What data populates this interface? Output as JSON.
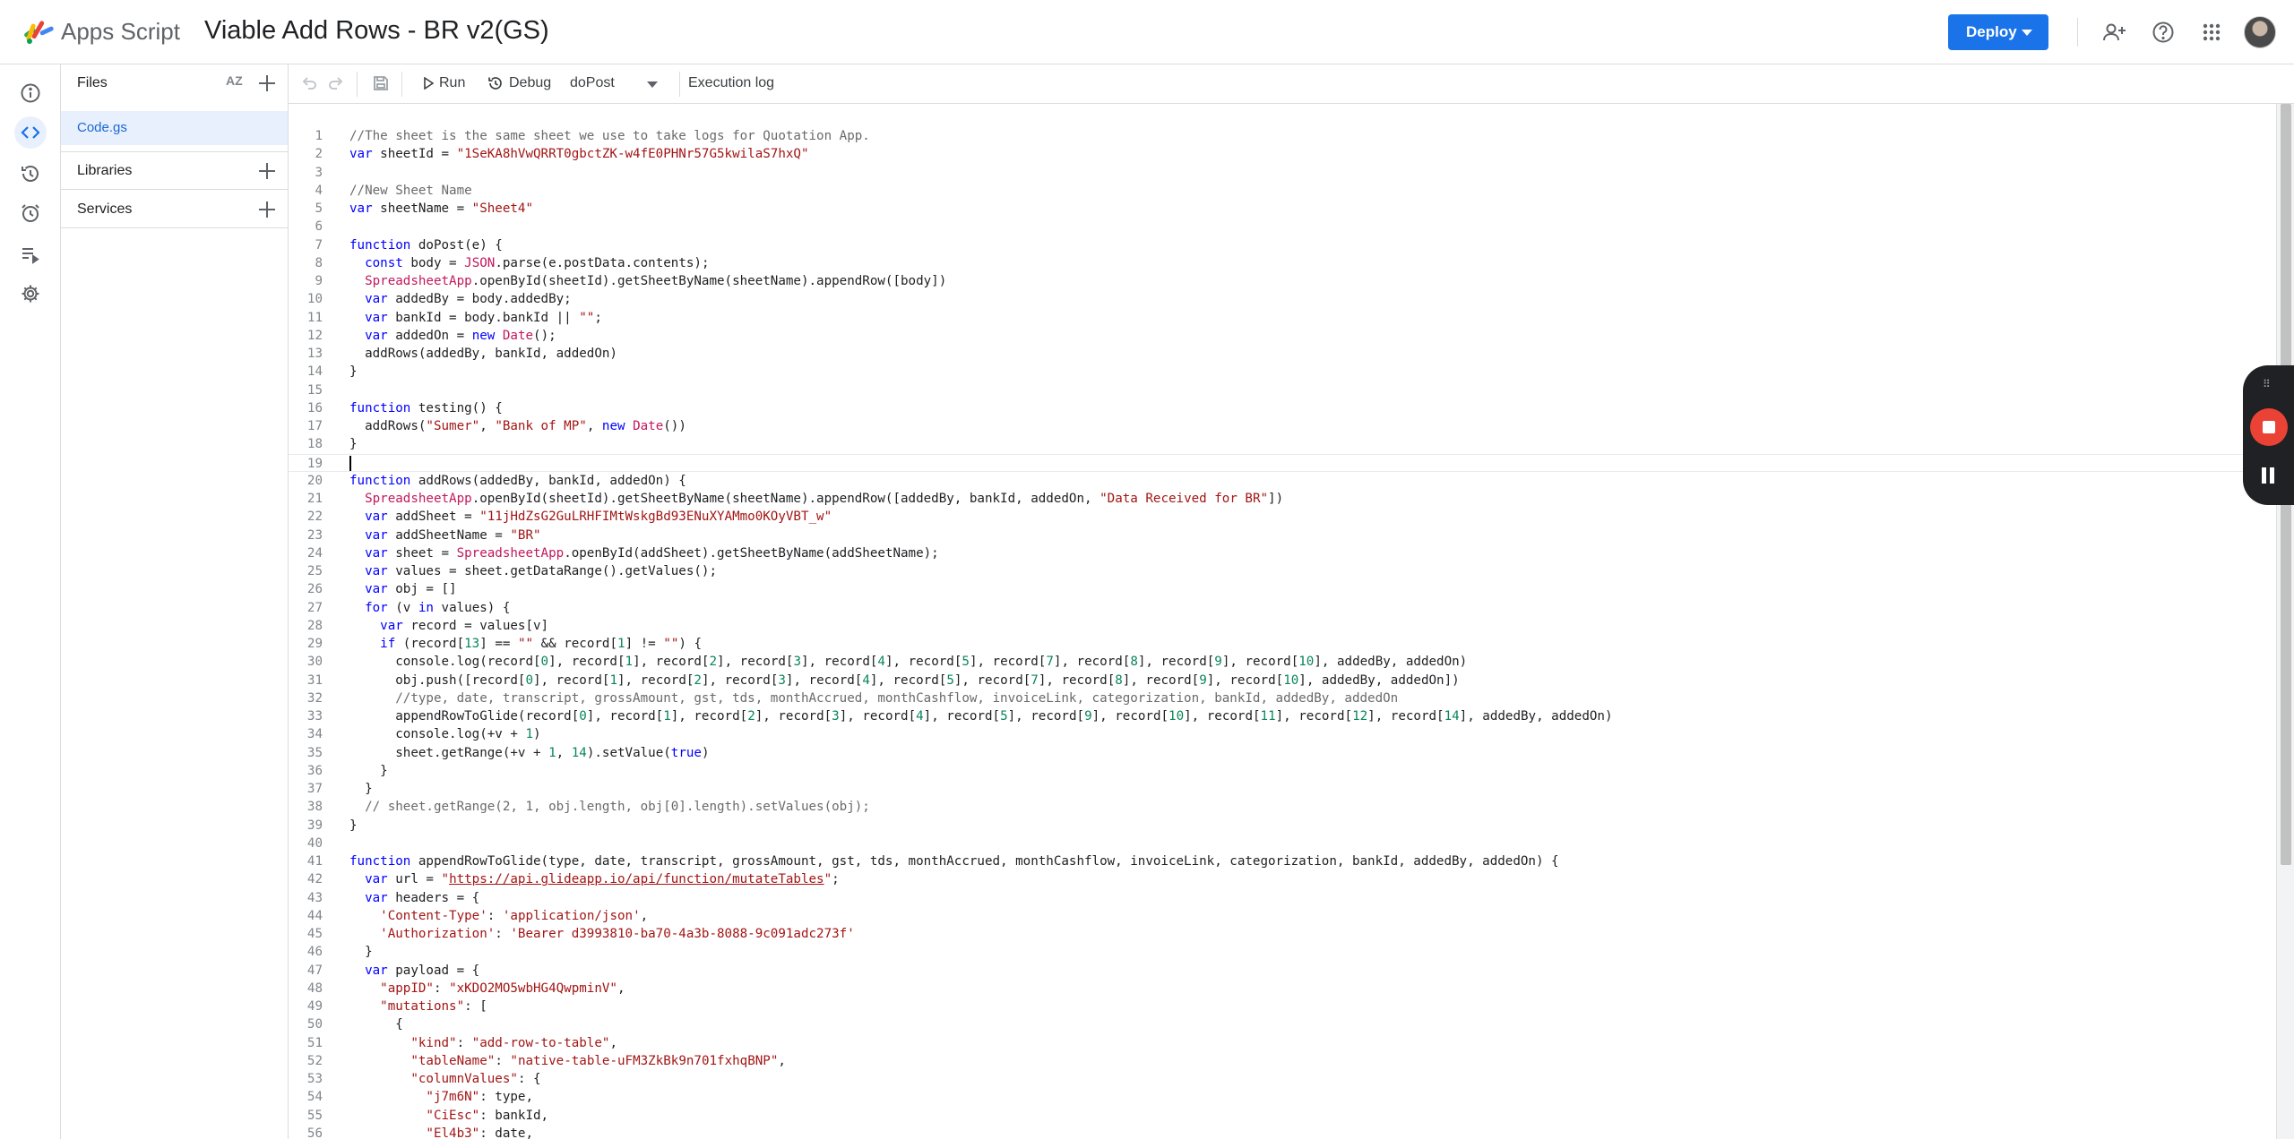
{
  "app": {
    "brand": "Apps Script",
    "project_title": "Viable Add Rows - BR v2(GS)",
    "deploy_label": "Deploy",
    "colors": {
      "accent": "#1a73e8",
      "stop": "#ea4335"
    }
  },
  "sidebar": {
    "files_label": "Files",
    "sort_label": "AZ",
    "file_name": "Code.gs",
    "libraries_label": "Libraries",
    "services_label": "Services"
  },
  "toolbar": {
    "run_label": "Run",
    "debug_label": "Debug",
    "function_name": "doPost",
    "execution_log_label": "Execution log"
  },
  "editor": {
    "current_line": 19,
    "lines": [
      "//The sheet is the same sheet we use to take logs for Quotation App.",
      "var sheetId = \"1SeKA8hVwQRRT0gbctZK-w4fE0PHNr57G5kwilaS7hxQ\"",
      "",
      "//New Sheet Name",
      "var sheetName = \"Sheet4\"",
      "",
      "function doPost(e) {",
      "  const body = JSON.parse(e.postData.contents);",
      "  SpreadsheetApp.openById(sheetId).getSheetByName(sheetName).appendRow([body])",
      "  var addedBy = body.addedBy;",
      "  var bankId = body.bankId || \"\";",
      "  var addedOn = new Date();",
      "  addRows(addedBy, bankId, addedOn)",
      "}",
      "",
      "function testing() {",
      "  addRows(\"Sumer\", \"Bank of MP\", new Date())",
      "}",
      "",
      "function addRows(addedBy, bankId, addedOn) {",
      "  SpreadsheetApp.openById(sheetId).getSheetByName(sheetName).appendRow([addedBy, bankId, addedOn, \"Data Received for BR\"])",
      "  var addSheet = \"11jHdZsG2GuLRHFIMtWskgBd93ENuXYAMmo0KOyVBT_w\"",
      "  var addSheetName = \"BR\"",
      "  var sheet = SpreadsheetApp.openById(addSheet).getSheetByName(addSheetName);",
      "  var values = sheet.getDataRange().getValues();",
      "  var obj = []",
      "  for (v in values) {",
      "    var record = values[v]",
      "    if (record[13] == \"\" && record[1] != \"\") {",
      "      console.log(record[0], record[1], record[2], record[3], record[4], record[5], record[7], record[8], record[9], record[10], addedBy, addedOn)",
      "      obj.push([record[0], record[1], record[2], record[3], record[4], record[5], record[7], record[8], record[9], record[10], addedBy, addedOn])",
      "      //type, date, transcript, grossAmount, gst, tds, monthAccrued, monthCashflow, invoiceLink, categorization, bankId, addedBy, addedOn",
      "      appendRowToGlide(record[0], record[1], record[2], record[3], record[4], record[5], record[9], record[10], record[11], record[12], record[14], addedBy, addedOn)",
      "      console.log(+v + 1)",
      "      sheet.getRange(+v + 1, 14).setValue(true)",
      "    }",
      "  }",
      "  // sheet.getRange(2, 1, obj.length, obj[0].length).setValues(obj);",
      "}",
      "",
      "function appendRowToGlide(type, date, transcript, grossAmount, gst, tds, monthAccrued, monthCashflow, invoiceLink, categorization, bankId, addedBy, addedOn) {",
      "  var url = \"https://api.glideapp.io/api/function/mutateTables\";",
      "  var headers = {",
      "    'Content-Type': 'application/json',",
      "    'Authorization': 'Bearer d3993810-ba70-4a3b-8088-9c091adc273f'",
      "  }",
      "  var payload = {",
      "    \"appID\": \"xKDO2MO5wbHG4QwpminV\",",
      "    \"mutations\": [",
      "      {",
      "        \"kind\": \"add-row-to-table\",",
      "        \"tableName\": \"native-table-uFM3ZkBk9n701fxhqBNP\",",
      "        \"columnValues\": {",
      "          \"j7m6N\": type,",
      "          \"CiEsc\": bankId,",
      "          \"El4b3\": date,"
    ]
  }
}
